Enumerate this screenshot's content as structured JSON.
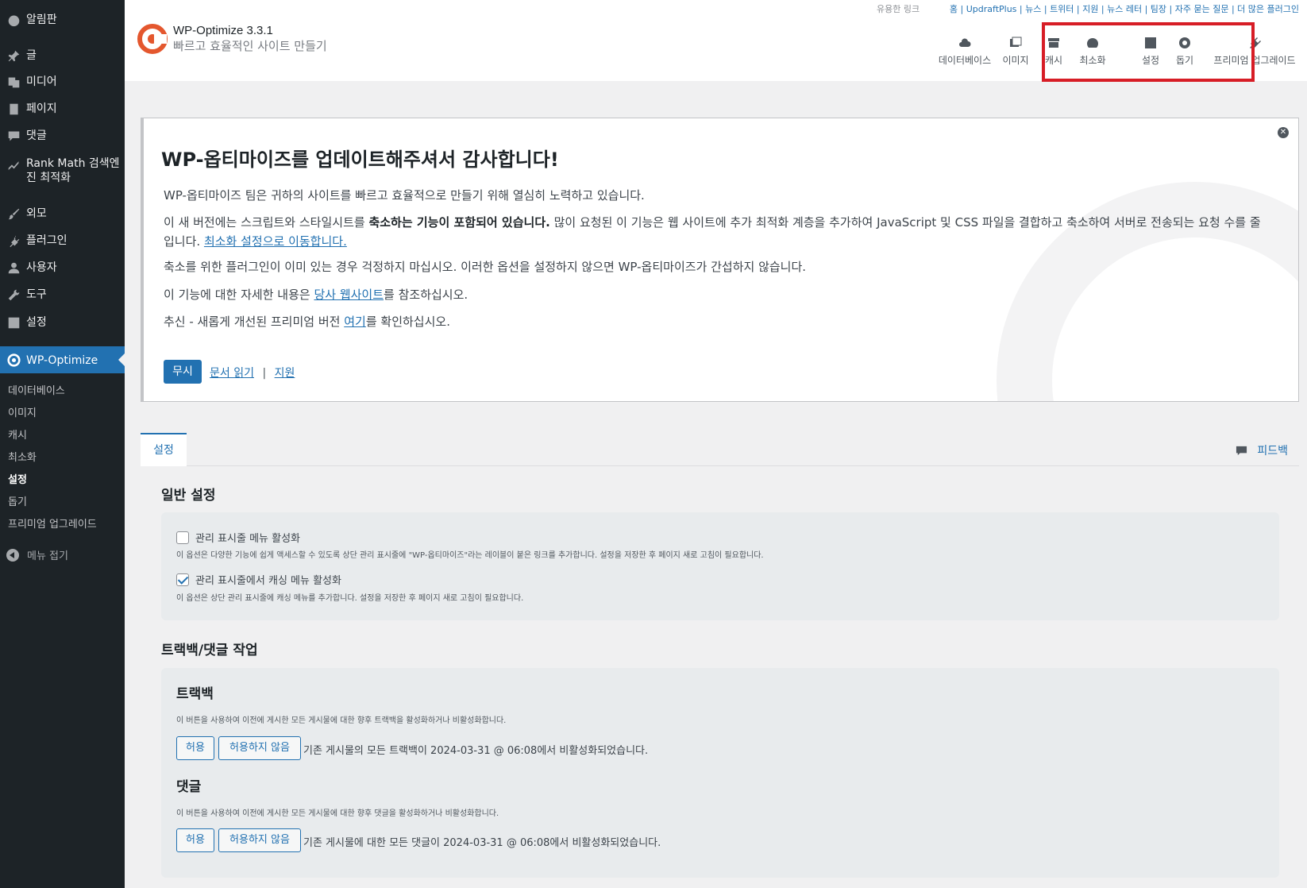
{
  "sidebar": {
    "items": [
      {
        "label": "알림판",
        "icon": "dashboard-icon"
      },
      {
        "label": "글",
        "icon": "pin-icon"
      },
      {
        "label": "미디어",
        "icon": "media-icon"
      },
      {
        "label": "페이지",
        "icon": "page-icon"
      },
      {
        "label": "댓글",
        "icon": "comment-icon"
      },
      {
        "label": "Rank Math 검색엔진 최적화",
        "icon": "rank-math-icon"
      },
      {
        "label": "외모",
        "icon": "brush-icon"
      },
      {
        "label": "플러그인",
        "icon": "plugin-icon"
      },
      {
        "label": "사용자",
        "icon": "user-icon"
      },
      {
        "label": "도구",
        "icon": "wrench-icon"
      },
      {
        "label": "설정",
        "icon": "settings-icon"
      },
      {
        "label": "WP-Optimize",
        "icon": "wp-optimize-icon"
      }
    ],
    "submenu": [
      "데이터베이스",
      "이미지",
      "캐시",
      "최소화",
      "설정",
      "돕기",
      "프리미엄 업그레이드"
    ],
    "collapse_label": "메뉴 접기"
  },
  "header": {
    "title": "WP-Optimize 3.3.1",
    "tagline": "빠르고 효율적인 사이트 만들기",
    "useful_links_label": "유용한 링크",
    "top_links": [
      "홈",
      "UpdraftPlus",
      "뉴스",
      "트위터",
      "지원",
      "뉴스 레터",
      "팀장",
      "자주 묻는 질문",
      "더 많은 플러그인"
    ],
    "tabs": [
      {
        "label": "데이터베이스",
        "icon": "cloud-icon"
      },
      {
        "label": "이미지",
        "icon": "images-icon"
      },
      {
        "label": "캐시",
        "icon": "archive-icon"
      },
      {
        "label": "최소화",
        "icon": "dashboard-gauge-icon"
      },
      {
        "label": "설정",
        "icon": "settings-grid-icon"
      },
      {
        "label": "돕기",
        "icon": "lifebuoy-icon"
      },
      {
        "label": "프리미엄 업그레이드",
        "icon": "plugin-upgrade-icon"
      }
    ],
    "highlight_color": "#d71d26",
    "accent_color": "#e97e2a"
  },
  "notice": {
    "title": "WP-옵티마이즈를 업데이트해주셔서 감사합니다!",
    "p1": "WP-옵티마이즈 팀은 귀하의 사이트를 빠르고 효율적으로 만들기 위해 열심히 노력하고 있습니다.",
    "p2_pre": "이 새 버전에는 스크립트와 스타일시트를 ",
    "p2_strong": "축소하는 기능이 포함되어 있습니다.",
    "p2_post": " 많이 요청된 이 기능은 웹 사이트에 추가 최적화 계층을 추가하여 JavaScript 및 CSS 파일을 결합하고 축소하여 서버로 전송되는 요청 수를 줄입니다. ",
    "p2_link": "최소화 설정으로 이동합니다.",
    "p3": "축소를 위한 플러그인이 이미 있는 경우 걱정하지 마십시오. 이러한 옵션을 설정하지 않으면 WP-옵티마이즈가 간섭하지 않습니다.",
    "p4_pre": "이 기능에 대한 자세한 내용은 ",
    "p4_link": "당사 웹사이트",
    "p4_post": "를 참조하십시오.",
    "p5_pre": "추신 - 새롭게 개선된 프리미엄 버전 ",
    "p5_link": "여기",
    "p5_post": "를 확인하십시오.",
    "dismiss": "무시",
    "read_docs": "문서 읽기",
    "link_sep": "|",
    "support": "지원",
    "close_glyph": "✕"
  },
  "tabs": {
    "settings": "설정",
    "feedback": "피드백"
  },
  "general": {
    "title": "일반 설정",
    "opt1_label": "관리 표시줄 메뉴 활성화",
    "opt1_checked": false,
    "opt1_desc": "이 옵션은 다양한 기능에 쉽게 액세스할 수 있도록 상단 관리 표시줄에 \"WP-옵티마이즈\"라는 레이블이 붙은 링크를 추가합니다. 설정을 저장한 후 페이지 새로 고침이 필요합니다.",
    "opt2_label": "관리 표시줄에서 캐싱 메뉴 활성화",
    "opt2_checked": true,
    "opt2_desc": "이 옵션은 상단 관리 표시줄에 캐싱 메뉴를 추가합니다. 설정을 저장한 후 페이지 새로 고침이 필요합니다."
  },
  "trackback": {
    "section_title": "트랙백/댓글 작업",
    "tb_title": "트랙백",
    "tb_desc": "이 버튼을 사용하여 이전에 게시한 모든 게시물에 대한 향후 트랙백을 활성화하거나 비활성화합니다.",
    "tb_allow": "허용",
    "tb_deny": "허용하지 않음",
    "tb_status": "기존 게시물의 모든 트랙백이 2024-03-31 @ 06:08에서 비활성화되었습니다.",
    "cm_title": "댓글",
    "cm_desc": "이 버튼을 사용하여 이전에 게시한 모든 게시물에 대한 향후 댓글을 활성화하거나 비활성화합니다.",
    "cm_allow": "허용",
    "cm_deny": "허용하지 않음",
    "cm_status": "기존 게시물에 대한 모든 댓글이 2024-03-31 @ 06:08에서 비활성화되었습니다."
  }
}
